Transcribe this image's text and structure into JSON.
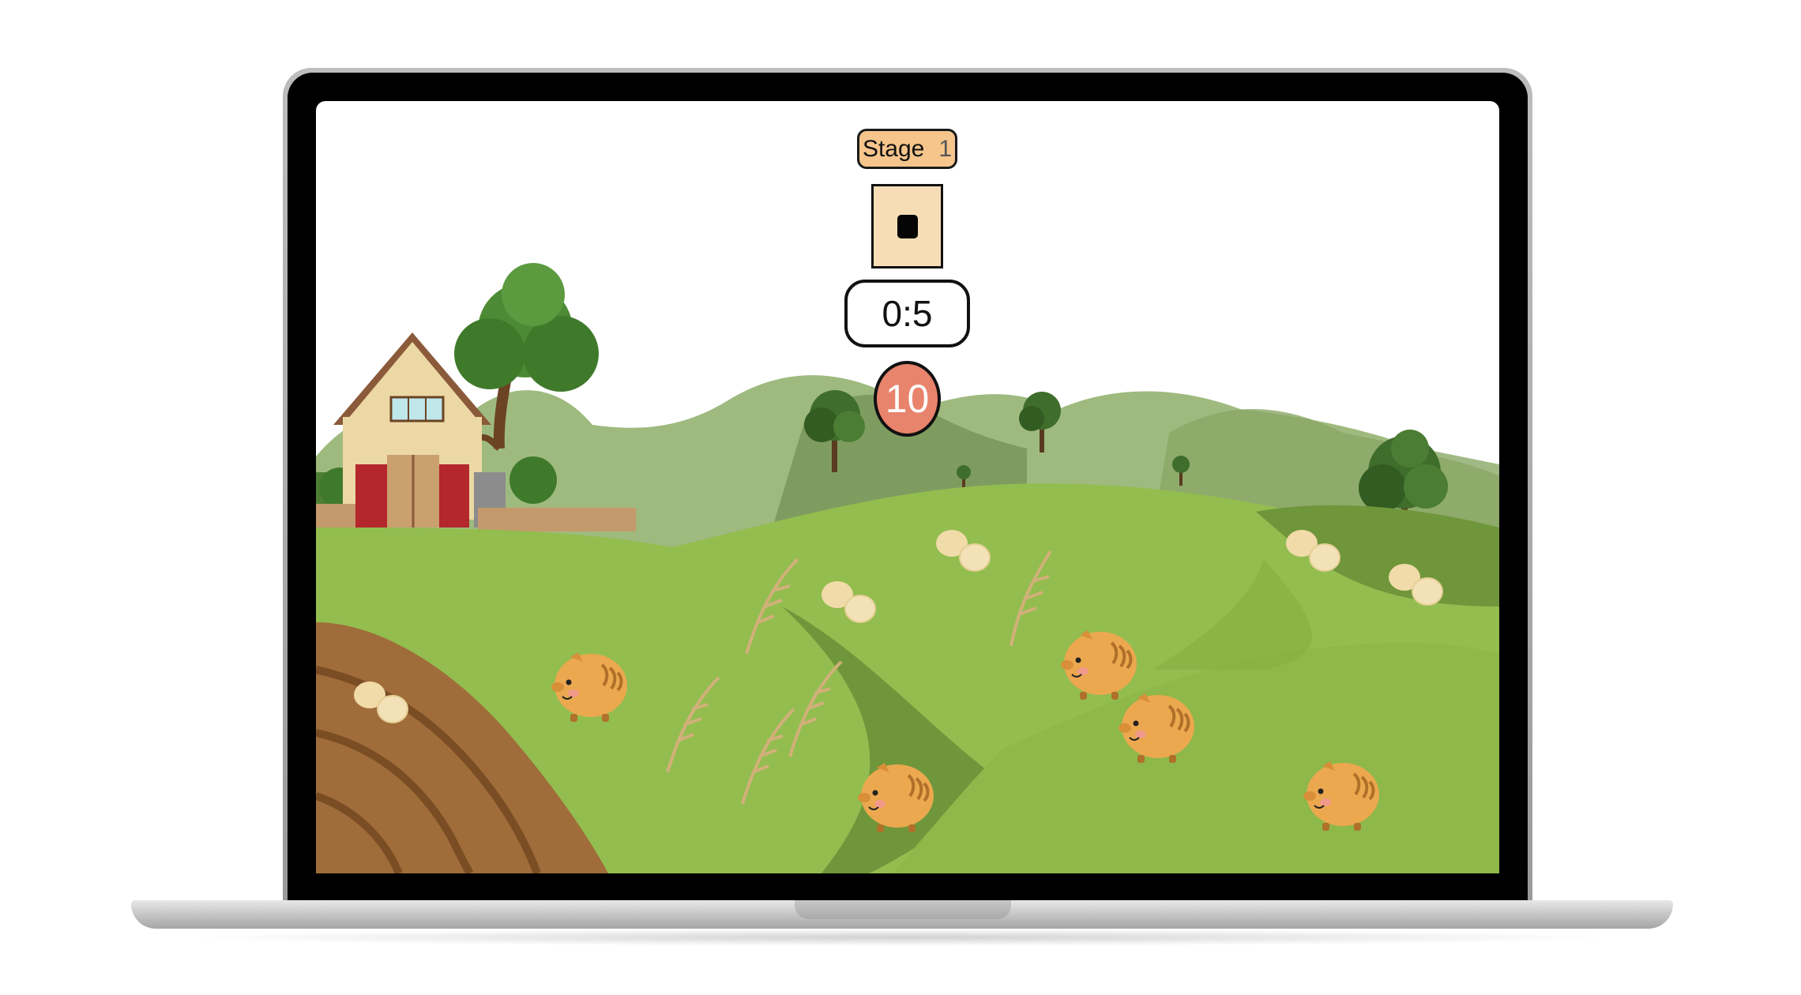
{
  "hud": {
    "stage_label": "Stage",
    "stage_number": "1",
    "timer": "0:5",
    "score": "10"
  },
  "icons": {
    "stop": "stop-icon",
    "boar": "wild-boar-icon",
    "egg": "egg-pair-icon",
    "reed": "reed-grass-icon",
    "barn": "barn-icon",
    "tree": "tree-icon"
  },
  "colors": {
    "stage_badge": "#f5c58c",
    "stop_button": "#f7ddb6",
    "score_badge": "#e8836c",
    "grass": "#93bd4f",
    "dark_grass": "#6f963a",
    "dirt": "#9c6a37",
    "boar": "#eba84f"
  }
}
